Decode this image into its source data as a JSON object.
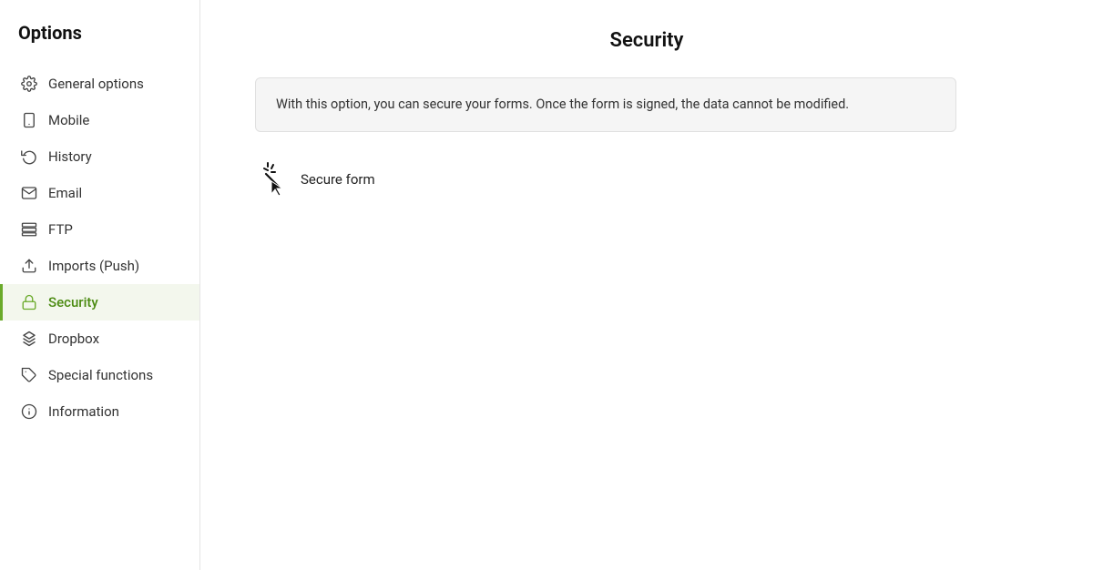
{
  "sidebar": {
    "title": "Options",
    "items": [
      {
        "id": "general-options",
        "label": "General options",
        "icon": "gear"
      },
      {
        "id": "mobile",
        "label": "Mobile",
        "icon": "mobile"
      },
      {
        "id": "history",
        "label": "History",
        "icon": "history"
      },
      {
        "id": "email",
        "label": "Email",
        "icon": "email"
      },
      {
        "id": "ftp",
        "label": "FTP",
        "icon": "ftp"
      },
      {
        "id": "imports-push",
        "label": "Imports (Push)",
        "icon": "imports"
      },
      {
        "id": "security",
        "label": "Security",
        "icon": "lock",
        "active": true
      },
      {
        "id": "dropbox",
        "label": "Dropbox",
        "icon": "dropbox"
      },
      {
        "id": "special-functions",
        "label": "Special functions",
        "icon": "tag"
      },
      {
        "id": "information",
        "label": "Information",
        "icon": "info"
      }
    ]
  },
  "main": {
    "title": "Security",
    "info_text": "With this option, you can secure your forms. Once the form is signed, the data cannot be modified.",
    "secure_form_label": "Secure form"
  }
}
